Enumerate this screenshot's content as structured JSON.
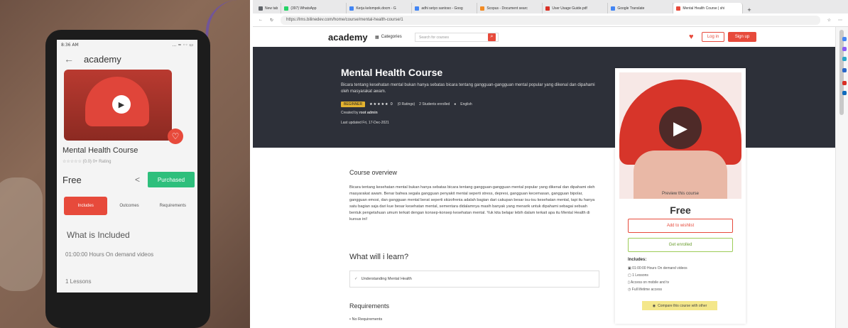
{
  "phone": {
    "status_time": "8:36 AM",
    "status_icons": "... ≈ ◦◦ ▭",
    "app_title": "academy",
    "course_title": "Mental Health Course",
    "rating_text": "☆☆☆☆☆ (0.0)  0+ Rating",
    "price": "Free",
    "purchased_label": "Purchased",
    "tabs": [
      "Includes",
      "Outcomes",
      "Requirements"
    ],
    "what_included": "What is Included",
    "hours": "01:00:00 Hours On demand videos",
    "lessons": "1 Lessons"
  },
  "browser": {
    "tabs": [
      {
        "label": "New tab",
        "color": "#5f6368"
      },
      {
        "label": "(397) WhatsApp",
        "color": "#25d366"
      },
      {
        "label": "Kerja kelompok.docm - G",
        "color": "#4285f4"
      },
      {
        "label": "adhi setyo santoso - Goog",
        "color": "#4285f4"
      },
      {
        "label": "Scopus - Document searc",
        "color": "#f28b24"
      },
      {
        "label": "User Usage Guide.pdf",
        "color": "#d93025"
      },
      {
        "label": "Google Translate",
        "color": "#4285f4"
      },
      {
        "label": "Mental Health Course | shi",
        "color": "#e74a3b"
      }
    ],
    "url": "https://lms.bilinedev.com/home/course/mental-health-course/1"
  },
  "site": {
    "logo": "academy",
    "categories": "Categories",
    "search_placeholder": "Search for courses",
    "login": "Log in",
    "signup": "Sign up"
  },
  "course": {
    "title": "Mental Health Course",
    "desc": "Bicara tentang kesehatan mental bukan hanya sebatas bicara tentang gangguan-gangguan mental popular yang dikenal dan dipahami oleh masyarakat awam.",
    "badge": "BEGINNER",
    "stars": "★★★★★ 0",
    "ratings": "(0 Ratings)",
    "students": "2 Students enrolled",
    "language": "English",
    "created_prefix": "Created by",
    "author": "root admin",
    "updated": "Last updated Fri, 17-Dec-2021",
    "overview_title": "Course overview",
    "overview": "Bicara tentang kesehatan mental bukan hanya sebatas bicara tentang gangguan-gangguan mental popular yang dikenal dan dipahami oleh masyarakat awam. Benar bahwa segala gangguan penyakit mental seperti stress, depresi, gangguan kecemasan, gangguan bipolar, gangguan emosi, dan gangguan mental berat seperti skizofrenia adalah bagian dari cakupan besar isu-isu kesehatan mental, tapi itu hanya satu bagian saja dari kue besar kesehatan mental, sementara didalamnya masih banyak yang menarik untuk dipahami sebagai sebuah bentuk pengetahuan umum terkait dengan konsep-konsep kesehatan mental. Yuk kita belajar lebih dalam terkait apa itu Mental Health di kursus ini!",
    "learn_title": "What will i learn?",
    "learn_item": "Understanding Mental Health",
    "req_title": "Requirements",
    "req_item": "No Requirements"
  },
  "card": {
    "preview": "Preview this course",
    "price": "Free",
    "wishlist": "Add to wishlist",
    "enroll": "Get enrolled",
    "includes_title": "Includes:",
    "includes": [
      "01:00:00 Hours On demand videos",
      "1 Lessons",
      "Access on mobile and tv",
      "Full lifetime access"
    ],
    "compare": "Compare this course with other"
  }
}
